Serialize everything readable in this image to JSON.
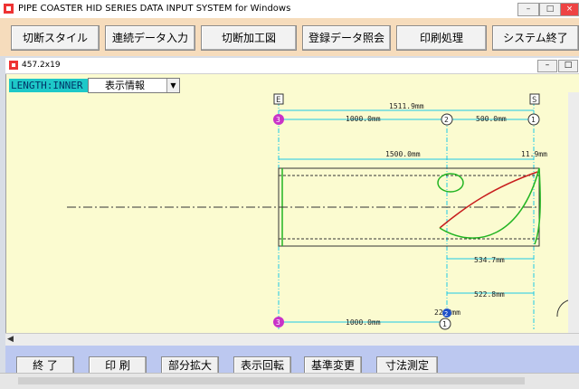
{
  "window": {
    "title": "PIPE COASTER HID SERIES   DATA INPUT SYSTEM for Windows"
  },
  "toolbar": {
    "buttons": [
      "切断スタイル",
      "連続データ入力",
      "切断加工図",
      "登録データ照会",
      "印刷処理",
      "システム終了"
    ]
  },
  "inner_window": {
    "title": "457.2x19"
  },
  "length_label": "LENGTH:INNER",
  "display_select": {
    "value": "表示情報"
  },
  "drawing": {
    "ref_left": "E",
    "ref_right": "S",
    "dim_overall": "1511.9mm",
    "dim_seg1": "1000.0mm",
    "dim_seg2": "500.0mm",
    "dim_pipe": "1500.0mm",
    "dim_small": "11.9mm",
    "dim_a": "534.7mm",
    "dim_b": "522.8mm",
    "dim_bottom": "1000.0mm",
    "dim_bottom_small": "22.2mm",
    "marker_3": "3",
    "marker_2": "2",
    "marker_1": "1",
    "colors": {
      "cyan": "#1ec8e6",
      "red": "#c81e1e",
      "green": "#22b422",
      "magenta": "#c832c8",
      "dark": "#333333"
    }
  },
  "bottom_toolbar": {
    "buttons": [
      "終 了",
      "印 刷",
      "部分拡大",
      "表示回転",
      "基準変更",
      "寸法測定"
    ]
  }
}
